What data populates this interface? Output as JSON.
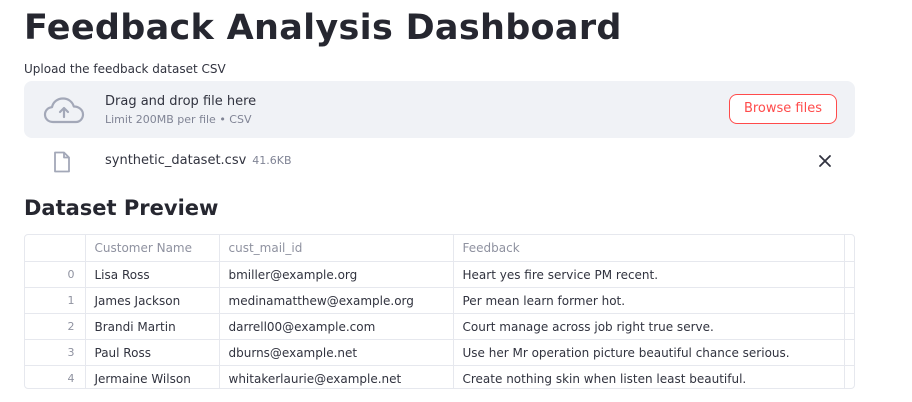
{
  "page": {
    "title": "Feedback Analysis Dashboard"
  },
  "uploader": {
    "label": "Upload the feedback dataset CSV",
    "drop_text": "Drag and drop file here",
    "limit_text": "Limit 200MB per file • CSV",
    "browse_label": "Browse files",
    "icon": "cloud-upload-icon"
  },
  "uploaded_file": {
    "name": "synthetic_dataset.csv",
    "size": "41.6KB",
    "icon": "file-icon",
    "remove_icon": "close-icon"
  },
  "preview": {
    "heading": "Dataset Preview",
    "columns": [
      "",
      "Customer Name",
      "cust_mail_id",
      "Feedback"
    ],
    "rows": [
      {
        "index": "0",
        "name": "Lisa Ross",
        "mail": "bmiller@example.org",
        "feedback": "Heart yes fire service PM recent."
      },
      {
        "index": "1",
        "name": "James Jackson",
        "mail": "medinamatthew@example.org",
        "feedback": "Per mean learn former hot."
      },
      {
        "index": "2",
        "name": "Brandi Martin",
        "mail": "darrell00@example.com",
        "feedback": "Court manage across job right true serve."
      },
      {
        "index": "3",
        "name": "Paul Ross",
        "mail": "dburns@example.net",
        "feedback": "Use her Mr operation picture beautiful chance serious."
      },
      {
        "index": "4",
        "name": "Jermaine Wilson",
        "mail": "whitakerlaurie@example.net",
        "feedback": "Create nothing skin when listen least beautiful."
      }
    ]
  },
  "colors": {
    "accent": "#ff4b4b",
    "dropzone_bg": "#f0f2f6",
    "text": "#31333f",
    "muted": "#808495"
  }
}
